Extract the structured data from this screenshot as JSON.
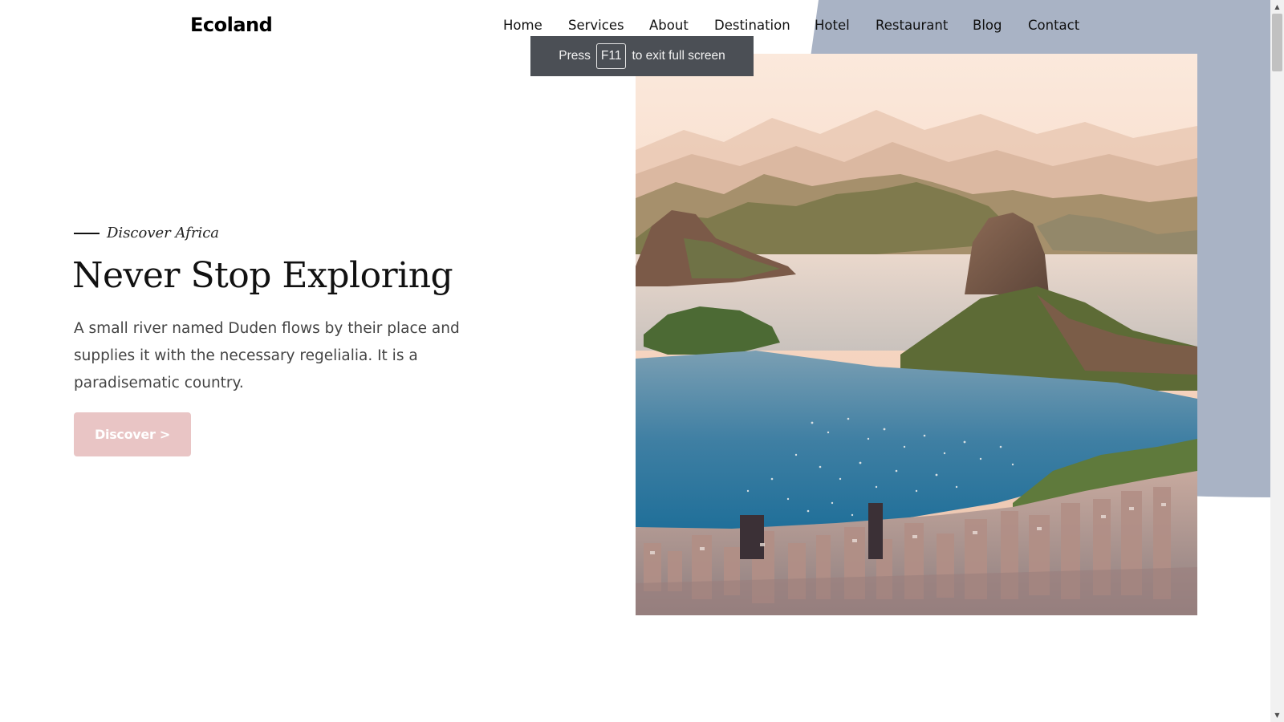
{
  "header": {
    "logo": "Ecoland",
    "nav": [
      "Home",
      "Services",
      "About",
      "Destination",
      "Hotel",
      "Restaurant",
      "Blog",
      "Contact"
    ]
  },
  "toast": {
    "prefix": "Press",
    "key": "F11",
    "suffix": "to exit full screen"
  },
  "hero": {
    "kicker": "Discover Africa",
    "title": "Never Stop Exploring",
    "description": "A small river named Duden flows by their place and supplies it with the necessary regelialia. It is a paradisematic country.",
    "button_label": "Discover >"
  },
  "colors": {
    "accent_shape": "#a9b3c5",
    "button_bg": "#e9c5c5",
    "toast_bg": "#4b4f55"
  }
}
